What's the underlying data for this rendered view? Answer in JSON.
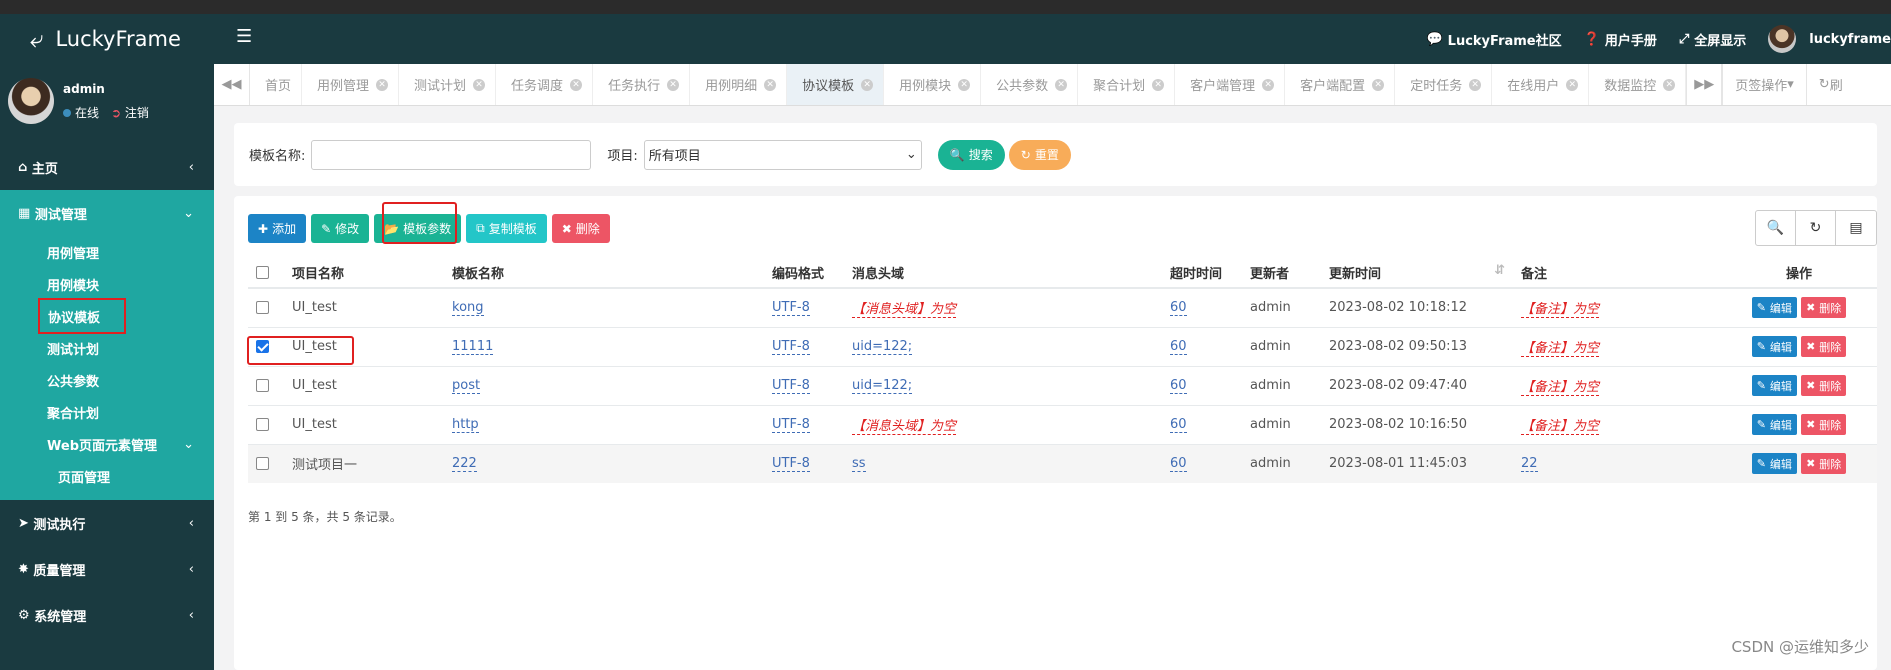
{
  "app": {
    "name": "LuckyFrame"
  },
  "topbar": {
    "community": "LuckyFrame社区",
    "manual": "用户手册",
    "fullscreen": "全屏显示",
    "user": "luckyframe"
  },
  "profile": {
    "name": "admin",
    "status": "在线",
    "logout": "注销"
  },
  "sidebar": {
    "home": "主页",
    "test_mgmt": "测试管理",
    "items": [
      "用例管理",
      "用例模块",
      "协议模板",
      "测试计划",
      "公共参数",
      "聚合计划"
    ],
    "web_elements": "Web页面元素管理",
    "page_mgmt": "页面管理",
    "test_exec": "测试执行",
    "quality": "质量管理",
    "system": "系统管理"
  },
  "tabs": [
    "首页",
    "用例管理",
    "测试计划",
    "任务调度",
    "任务执行",
    "用例明细",
    "协议模板",
    "用例模块",
    "公共参数",
    "聚合计划",
    "客户端管理",
    "客户端配置",
    "定时任务",
    "在线用户",
    "数据监控"
  ],
  "tab_ops": "页签操作",
  "tab_refresh": "刷",
  "search": {
    "template_label": "模板名称:",
    "template_value": "",
    "project_label": "项目:",
    "project_value": "所有项目",
    "search_btn": "搜索",
    "reset_btn": "重置"
  },
  "toolbar": {
    "add": "添加",
    "edit": "修改",
    "params": "模板参数",
    "copy": "复制模板",
    "delete": "删除"
  },
  "table": {
    "headers": [
      "项目名称",
      "模板名称",
      "编码格式",
      "消息头域",
      "超时时间",
      "更新者",
      "更新时间",
      "备注",
      "操作"
    ],
    "rows": [
      {
        "project": "UI_test",
        "template": "kong",
        "encoding": "UTF-8",
        "header": "【消息头域】为空",
        "timeout": "60",
        "updater": "admin",
        "time": "2023-08-02 10:18:12",
        "remark": "【备注】为空",
        "checked": false
      },
      {
        "project": "UI_test",
        "template": "11111",
        "encoding": "UTF-8",
        "header": "uid=122;",
        "timeout": "60",
        "updater": "admin",
        "time": "2023-08-02 09:50:13",
        "remark": "【备注】为空",
        "checked": true
      },
      {
        "project": "UI_test",
        "template": "post",
        "encoding": "UTF-8",
        "header": "uid=122;",
        "timeout": "60",
        "updater": "admin",
        "time": "2023-08-02 09:47:40",
        "remark": "【备注】为空",
        "checked": false
      },
      {
        "project": "UI_test",
        "template": "http",
        "encoding": "UTF-8",
        "header": "【消息头域】为空",
        "timeout": "60",
        "updater": "admin",
        "time": "2023-08-02 10:16:50",
        "remark": "【备注】为空",
        "checked": false
      },
      {
        "project": "测试项目一",
        "template": "222",
        "encoding": "UTF-8",
        "header": "ss",
        "timeout": "60",
        "updater": "admin",
        "time": "2023-08-01 11:45:03",
        "remark": "22",
        "checked": false
      }
    ],
    "edit_label": "编辑",
    "del_label": "删除"
  },
  "pagination": "第 1 到 5 条，共 5 条记录。",
  "watermark": "CSDN @运维知多少",
  "colors": {
    "sidebar": "#1a3a40",
    "submenu": "#1fa7a1",
    "primary": "#1c84c6",
    "green": "#1ab394",
    "teal": "#23c6c8",
    "orange": "#f8ac59",
    "danger": "#ed5565"
  }
}
